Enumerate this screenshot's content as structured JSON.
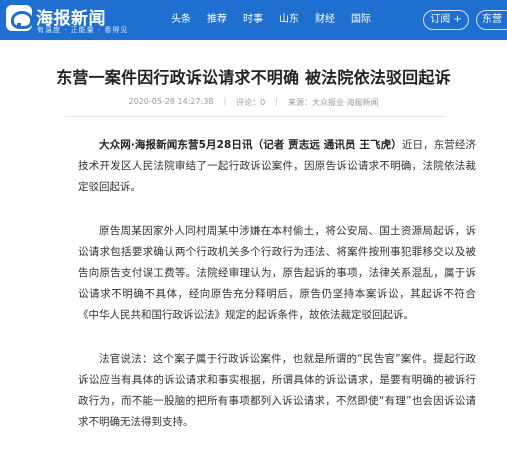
{
  "header": {
    "logo_text": "海报新闻",
    "logo_slogan": "有温度 · 正能量 · 看得见",
    "nav": [
      "头条",
      "推荐",
      "时事",
      "山东",
      "财经",
      "国际"
    ],
    "subscribe_label": "订阅 +",
    "region_label": "东营"
  },
  "article": {
    "title": "东营一案件因行政诉讼请求不明确 被法院依法驳回起诉",
    "time": "2020-05-28 14:27:38",
    "comments": "评论：0",
    "source": "来源：大众报业·海报新闻",
    "dateline": "大众网·海报新闻东营5月28日讯（记者 贾志远 通讯员 王飞虎）",
    "p1_text": "近日，东营经济技术开发区人民法院审结了一起行政诉讼案件，因原告诉讼请求不明确，法院依法裁定驳回起诉。",
    "p2": "原告周某因家外人同村周某中涉嫌在本村偷土，将公安局、国土资源局起诉，诉讼请求包括要求确认两个行政机关多个行政行为违法、将案件按刑事犯罪移交以及被告向原告支付误工费等。法院经审理认为，原告起诉的事项，法律关系混乱，属于诉讼请求不明确不具体，经向原告充分释明后，原告仍坚持本案诉讼，其起诉不符合《中华人民共和国行政诉讼法》规定的起诉条件，故依法裁定驳回起诉。",
    "p3": "法官说法：这个案子属于行政诉讼案件，也就是所谓的“民告官”案件。提起行政诉讼应当有具体的诉讼请求和事实根据，所谓具体的诉讼请求，是要有明确的被诉行政行为，而不能一股脑的把所有事项都列入诉讼请求，不然即使“有理”也会因诉讼请求不明确无法得到支持。"
  }
}
